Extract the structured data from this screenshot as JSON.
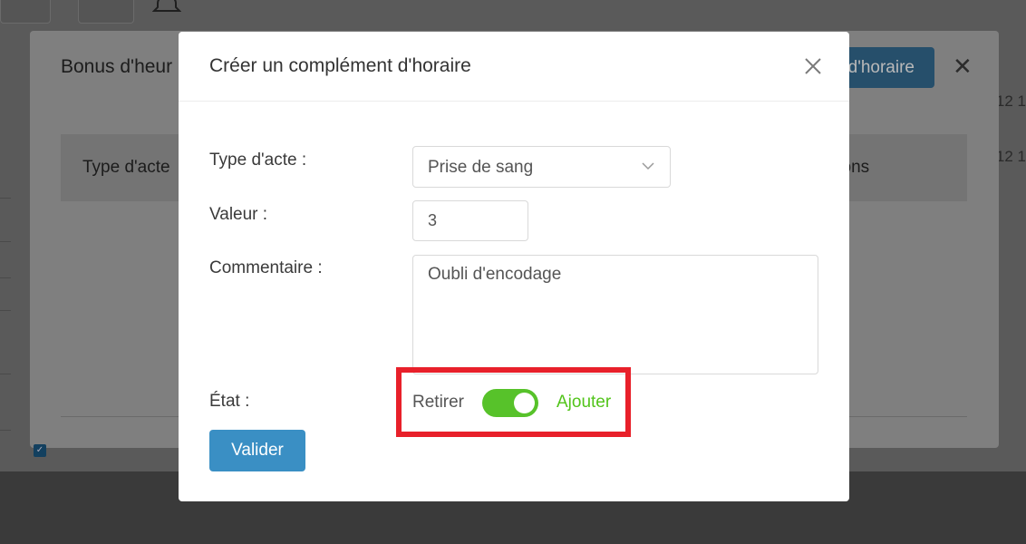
{
  "background": {
    "modal_title": "Bonus d'heur",
    "header_button_label": "d'horaire",
    "close_glyph": "✕",
    "table": {
      "col_left": "Type d'acte",
      "col_right": "tions"
    },
    "right_edge_text": [
      "12 1",
      "12 1"
    ]
  },
  "modal": {
    "title": "Créer un complément d'horaire",
    "fields": {
      "type_label": "Type d'acte :",
      "type_value": "Prise de sang",
      "value_label": "Valeur :",
      "value_value": "3",
      "comment_label": "Commentaire :",
      "comment_value": "Oubli d'encodage",
      "state_label": "État :",
      "state_off_label": "Retirer",
      "state_on_label": "Ajouter",
      "state_on": true
    },
    "submit_label": "Valider"
  },
  "colors": {
    "accent": "#3a8fc4",
    "toggle_on": "#57c22a",
    "highlight": "#e8202a"
  },
  "icons": {
    "close": "close-icon",
    "select_arrow": "chevron-down-icon"
  }
}
